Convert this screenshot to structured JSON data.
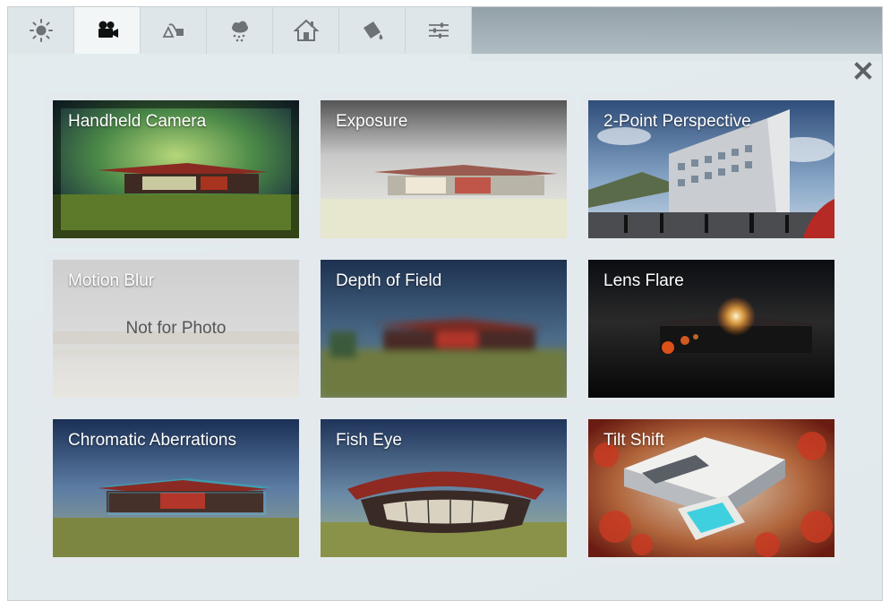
{
  "tabs": [
    {
      "icon": "sun-icon",
      "active": false
    },
    {
      "icon": "video-camera-icon",
      "active": true
    },
    {
      "icon": "curve-shapes-icon",
      "active": false
    },
    {
      "icon": "weather-icon",
      "active": false
    },
    {
      "icon": "house-icon",
      "active": false
    },
    {
      "icon": "paint-bucket-icon",
      "active": false
    },
    {
      "icon": "sliders-icon",
      "active": false
    }
  ],
  "close_icon": "close-icon",
  "effects": [
    {
      "title": "Handheld Camera"
    },
    {
      "title": "Exposure"
    },
    {
      "title": "2-Point Perspective"
    },
    {
      "title": "Motion Blur",
      "note": "Not for Photo"
    },
    {
      "title": "Depth of Field"
    },
    {
      "title": "Lens Flare"
    },
    {
      "title": "Chromatic Aberrations"
    },
    {
      "title": "Fish Eye"
    },
    {
      "title": "Tilt Shift"
    }
  ]
}
